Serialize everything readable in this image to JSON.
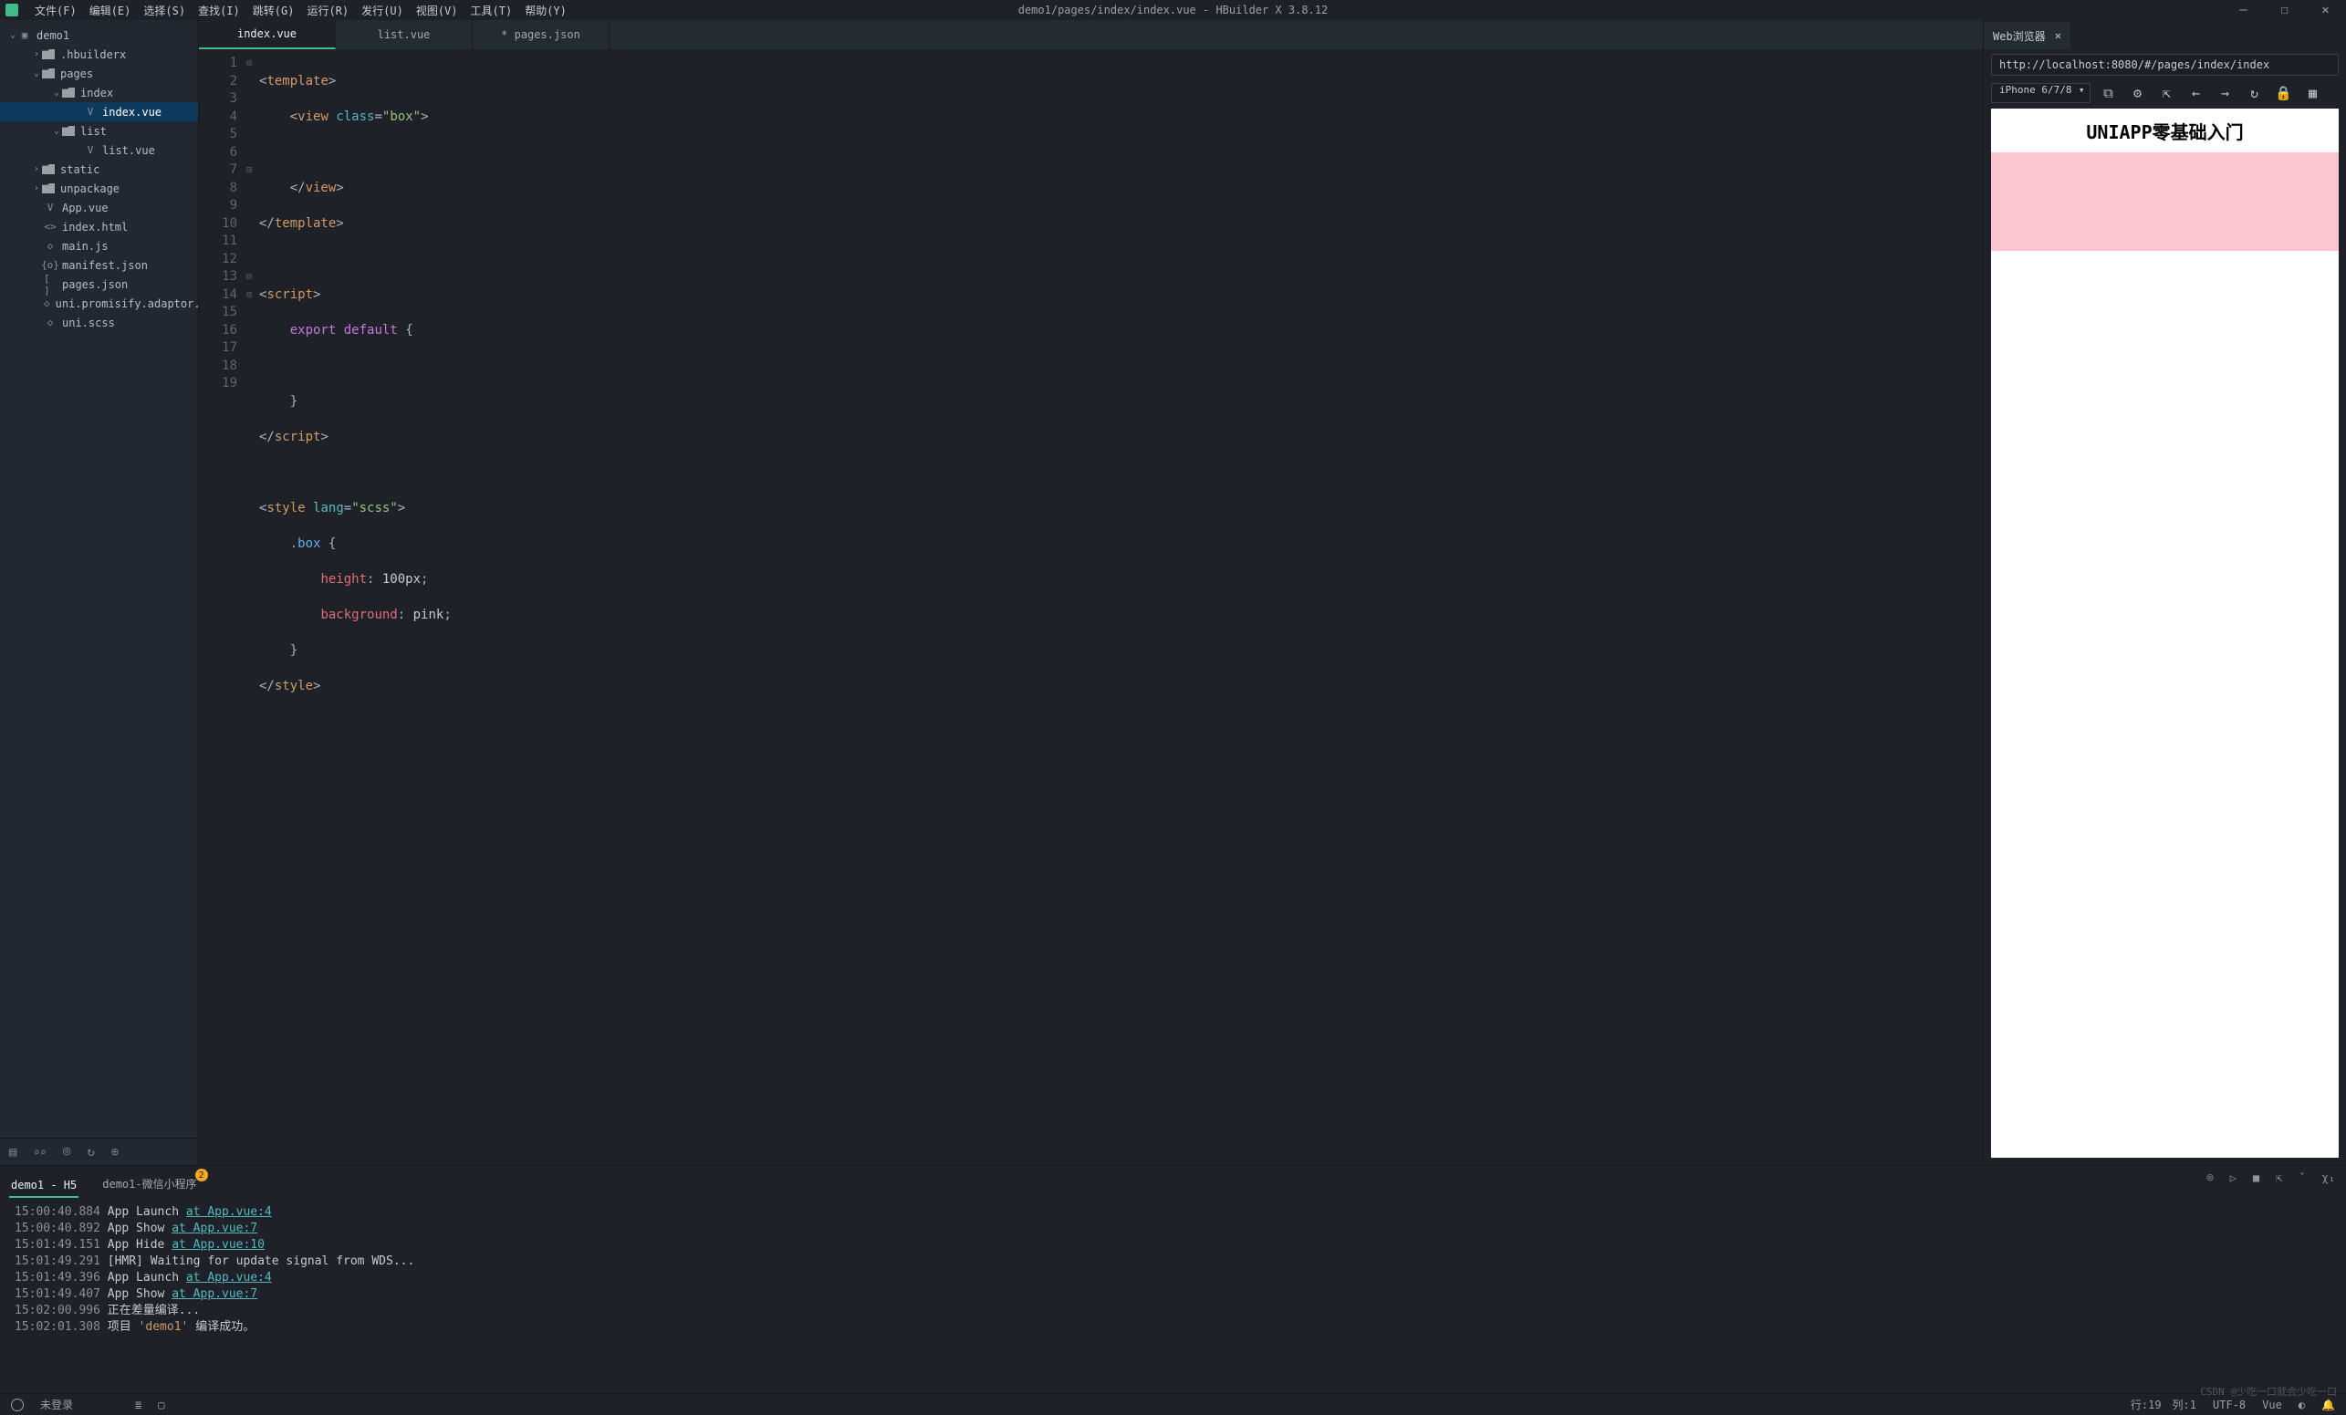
{
  "menubar": {
    "items": [
      "文件(F)",
      "编辑(E)",
      "选择(S)",
      "查找(I)",
      "跳转(G)",
      "运行(R)",
      "发行(U)",
      "视图(V)",
      "工具(T)",
      "帮助(Y)"
    ],
    "title": "demo1/pages/index/index.vue - HBuilder X 3.8.12"
  },
  "sidebar": {
    "project": "demo1",
    "tree": [
      {
        "indent": 34,
        "chev": "›",
        "folder": true,
        "label": ".hbuilderx"
      },
      {
        "indent": 34,
        "chev": "⌄",
        "folder": true,
        "label": "pages"
      },
      {
        "indent": 56,
        "chev": "⌄",
        "folder": true,
        "label": "index"
      },
      {
        "indent": 92,
        "icon": "V",
        "label": "index.vue",
        "selected": true
      },
      {
        "indent": 56,
        "chev": "⌄",
        "folder": true,
        "label": "list"
      },
      {
        "indent": 92,
        "icon": "V",
        "label": "list.vue"
      },
      {
        "indent": 34,
        "chev": "›",
        "folder": true,
        "label": "static"
      },
      {
        "indent": 34,
        "chev": "›",
        "folder": true,
        "label": "unpackage"
      },
      {
        "indent": 48,
        "icon": "V",
        "label": "App.vue"
      },
      {
        "indent": 48,
        "icon": "<>",
        "label": "index.html"
      },
      {
        "indent": 48,
        "icon": "◇",
        "label": "main.js"
      },
      {
        "indent": 48,
        "icon": "{o}",
        "label": "manifest.json"
      },
      {
        "indent": 48,
        "icon": "[ ]",
        "label": "pages.json"
      },
      {
        "indent": 48,
        "icon": "◇",
        "label": "uni.promisify.adaptor.js"
      },
      {
        "indent": 48,
        "icon": "◇",
        "label": "uni.scss"
      }
    ]
  },
  "tabs": [
    {
      "label": "index.vue",
      "active": true
    },
    {
      "label": "list.vue"
    },
    {
      "label": "* pages.json"
    }
  ],
  "code": {
    "lines": [
      "1",
      "2",
      "3",
      "4",
      "5",
      "6",
      "7",
      "8",
      "9",
      "10",
      "11",
      "12",
      "13",
      "14",
      "15",
      "16",
      "17",
      "18",
      "19"
    ],
    "fold": [
      "⊟",
      "",
      "",
      "",
      "",
      "",
      "⊟",
      "",
      "",
      "",
      "",
      "",
      "⊟",
      "⊟",
      "",
      "",
      "",
      "",
      ""
    ]
  },
  "browser": {
    "tab": "Web浏览器",
    "url": "http://localhost:8080/#/pages/index/index",
    "device": "iPhone 6/7/8",
    "previewTitle": "UNIAPP零基础入门"
  },
  "console": {
    "tabs": [
      {
        "label": "demo1 - H5",
        "active": true
      },
      {
        "label": "demo1-微信小程序",
        "badge": "2"
      }
    ],
    "lines": [
      {
        "ts": "15:00:40.884",
        "msg": "App Launch",
        "link": "at App.vue:4"
      },
      {
        "ts": "15:00:40.892",
        "msg": "App Show",
        "link": "at App.vue:7"
      },
      {
        "ts": "15:01:49.151",
        "msg": "App Hide",
        "link": "at App.vue:10"
      },
      {
        "ts": "15:01:49.291",
        "msg": "[HMR] Waiting for update signal from WDS..."
      },
      {
        "ts": "15:01:49.396",
        "msg": "App Launch",
        "link": "at App.vue:4"
      },
      {
        "ts": "15:01:49.407",
        "msg": "App Show",
        "link": "at App.vue:7"
      },
      {
        "ts": "15:02:00.996",
        "msg": "正在差量编译..."
      },
      {
        "ts": "15:02:01.308",
        "msg_pre": "项目 ",
        "ystr": "'demo1'",
        "msg_post": " 编译成功。"
      }
    ]
  },
  "status": {
    "login": "未登录",
    "pos": "行:19　列:1",
    "enc": "UTF-8",
    "lang": "Vue"
  },
  "watermark": "CSDN @少吃一口就会少吃一口"
}
